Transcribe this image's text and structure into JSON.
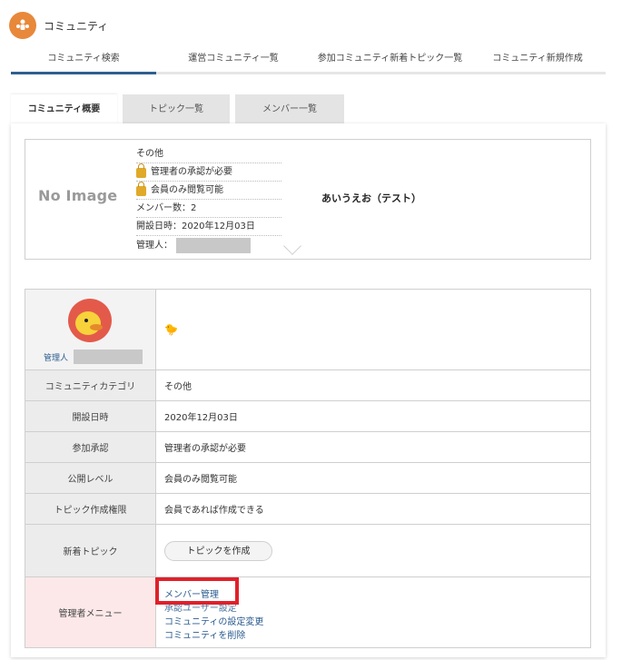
{
  "header": {
    "title": "コミュニティ"
  },
  "nav": {
    "items": [
      {
        "label": "コミュニティ検索"
      },
      {
        "label": "運営コミュニティ一覧"
      },
      {
        "label": "参加コミュニティ新着トピック一覧"
      },
      {
        "label": "コミュニティ新規作成"
      }
    ]
  },
  "tabs": [
    {
      "label": "コミュニティ概要"
    },
    {
      "label": "トピック一覧"
    },
    {
      "label": "メンバー一覧"
    }
  ],
  "summary": {
    "no_image": "No Image",
    "category": "その他",
    "approval": "管理者の承認が必要",
    "visibility": "会員のみ閲覧可能",
    "member_count": "メンバー数：2",
    "created": "開設日時：2020年12月03日",
    "admin_label": "管理人：",
    "community_name": "あいうえお（テスト）"
  },
  "detail": {
    "admin_caption": "管理人",
    "rows": [
      {
        "label": "コミュニティカテゴリ",
        "value": "その他"
      },
      {
        "label": "開設日時",
        "value": "2020年12月03日"
      },
      {
        "label": "参加承認",
        "value": "管理者の承認が必要"
      },
      {
        "label": "公開レベル",
        "value": "会員のみ閲覧可能"
      },
      {
        "label": "トピック作成権限",
        "value": "会員であれば作成できる"
      }
    ],
    "new_topic_label": "新着トピック",
    "create_topic_button": "トピックを作成",
    "admin_menu_label": "管理者メニュー",
    "admin_links": {
      "member_manage": "メンバー管理",
      "obscured": "承認ユーザー設定",
      "settings": "コミュニティの設定変更",
      "delete": "コミュニティを削除"
    }
  },
  "colors": {
    "accent": "#2f5f8f",
    "logo": "#e8883a",
    "highlight": "#e0202a",
    "admin_row": "#fce8e8"
  },
  "icons": {
    "logo": "community-icon",
    "lock": "lock-icon",
    "chick": "chick-icon"
  }
}
